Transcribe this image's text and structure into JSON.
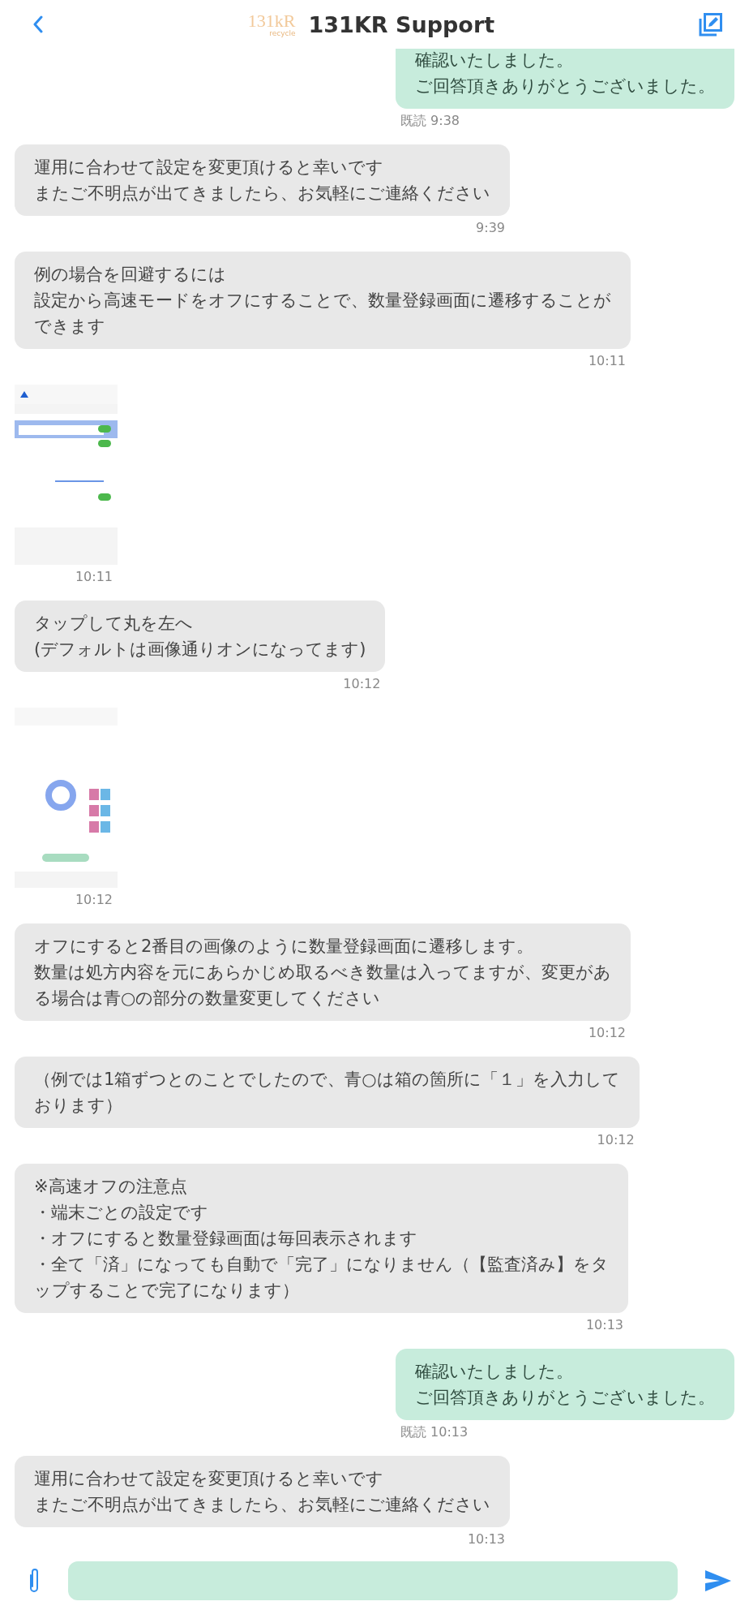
{
  "header": {
    "logo_main": "131kR",
    "logo_sub": "recycle",
    "title": "131KR Support"
  },
  "messages": [
    {
      "kind": "text",
      "outgoing": true,
      "lines": [
        "確認いたしました。",
        "ご回答頂きありがとうございました。"
      ],
      "read": "既読",
      "time": "9:38"
    },
    {
      "kind": "text",
      "outgoing": false,
      "lines": [
        "運用に合わせて設定を変更頂けると幸いです",
        "またご不明点が出てきましたら、お気軽にご連絡ください"
      ],
      "time": "9:39"
    },
    {
      "kind": "text",
      "outgoing": false,
      "lines": [
        "例の場合を回避するには",
        "設定から高速モードをオフにすることで、数量登録画面に遷移することが",
        "できます"
      ],
      "time": "10:11"
    },
    {
      "kind": "picture",
      "time": "10:11"
    },
    {
      "kind": "text",
      "outgoing": false,
      "lines": [
        "タップして丸を左へ",
        "(デフォルトは画像通りオンになってます)"
      ],
      "time": "10:12"
    },
    {
      "kind": "picture",
      "time": "10:12"
    },
    {
      "kind": "text",
      "outgoing": false,
      "lines": [
        "オフにすると2番目の画像のように数量登録画面に遷移します。",
        "数量は処方内容を元にあらかじめ取るべき数量は入ってますが、変更があ",
        "る場合は青○の部分の数量変更してください"
      ],
      "time": "10:12"
    },
    {
      "kind": "text",
      "outgoing": false,
      "lines": [
        "（例では1箱ずつとのことでしたので、青○は箱の箇所に「１」を入力して",
        "おります）"
      ],
      "time": "10:12"
    },
    {
      "kind": "text",
      "outgoing": false,
      "lines": [
        "※高速オフの注意点",
        "・端末ごとの設定です",
        "・オフにすると数量登録画面は毎回表示されます",
        "・全て「済」になっても自動で「完了」になりません（【監査済み】をタ",
        "ップすることで完了になります）"
      ],
      "time": "10:13"
    },
    {
      "kind": "text",
      "outgoing": true,
      "lines": [
        "確認いたしました。",
        "ご回答頂きありがとうございました。"
      ],
      "read": "既読",
      "time": "10:13"
    },
    {
      "kind": "text",
      "outgoing": false,
      "lines": [
        "運用に合わせて設定を変更頂けると幸いです",
        "またご不明点が出てきましたら、お気軽にご連絡ください"
      ],
      "time": "10:13"
    }
  ]
}
